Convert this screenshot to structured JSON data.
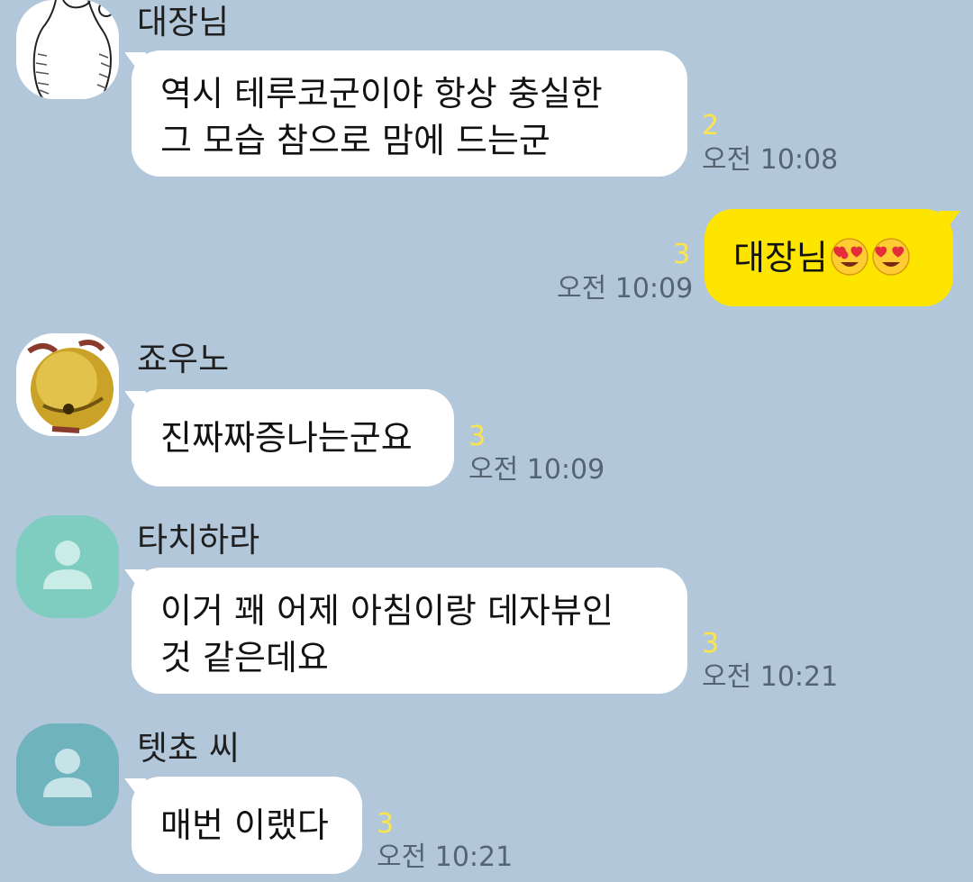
{
  "colors": {
    "background": "#b2c7da",
    "bubble_incoming": "#ffffff",
    "bubble_outgoing": "#fee500",
    "unread": "#fbe54a",
    "time": "#556473",
    "avatar_teal_1": "#7ecdc0",
    "avatar_teal_2": "#6fb3bd"
  },
  "messages": [
    {
      "sender": "대장님",
      "avatar": "sketch-portrait",
      "lines": [
        "역시 테루코군이야 항상 충실한",
        "그 모습 참으로 맘에 드는군"
      ],
      "unread": "2",
      "time": "오전 10:08"
    },
    {
      "sender": "me",
      "text": "대장님",
      "emoji": [
        "heart-eyes-emoji",
        "heart-eyes-emoji"
      ],
      "unread": "3",
      "time": "오전 10:09"
    },
    {
      "sender": "죠우노",
      "avatar": "golden-bell",
      "lines": [
        "진짜짜증나는군요"
      ],
      "unread": "3",
      "time": "오전 10:09"
    },
    {
      "sender": "타치하라",
      "avatar": "default-profile",
      "lines": [
        "이거 꽤 어제 아침이랑 데자뷰인",
        "것 같은데요"
      ],
      "unread": "3",
      "time": "오전 10:21"
    },
    {
      "sender": "텟쵸 씨",
      "avatar": "default-profile",
      "lines": [
        "매번 이랬다"
      ],
      "unread": "3",
      "time": "오전 10:21"
    }
  ]
}
